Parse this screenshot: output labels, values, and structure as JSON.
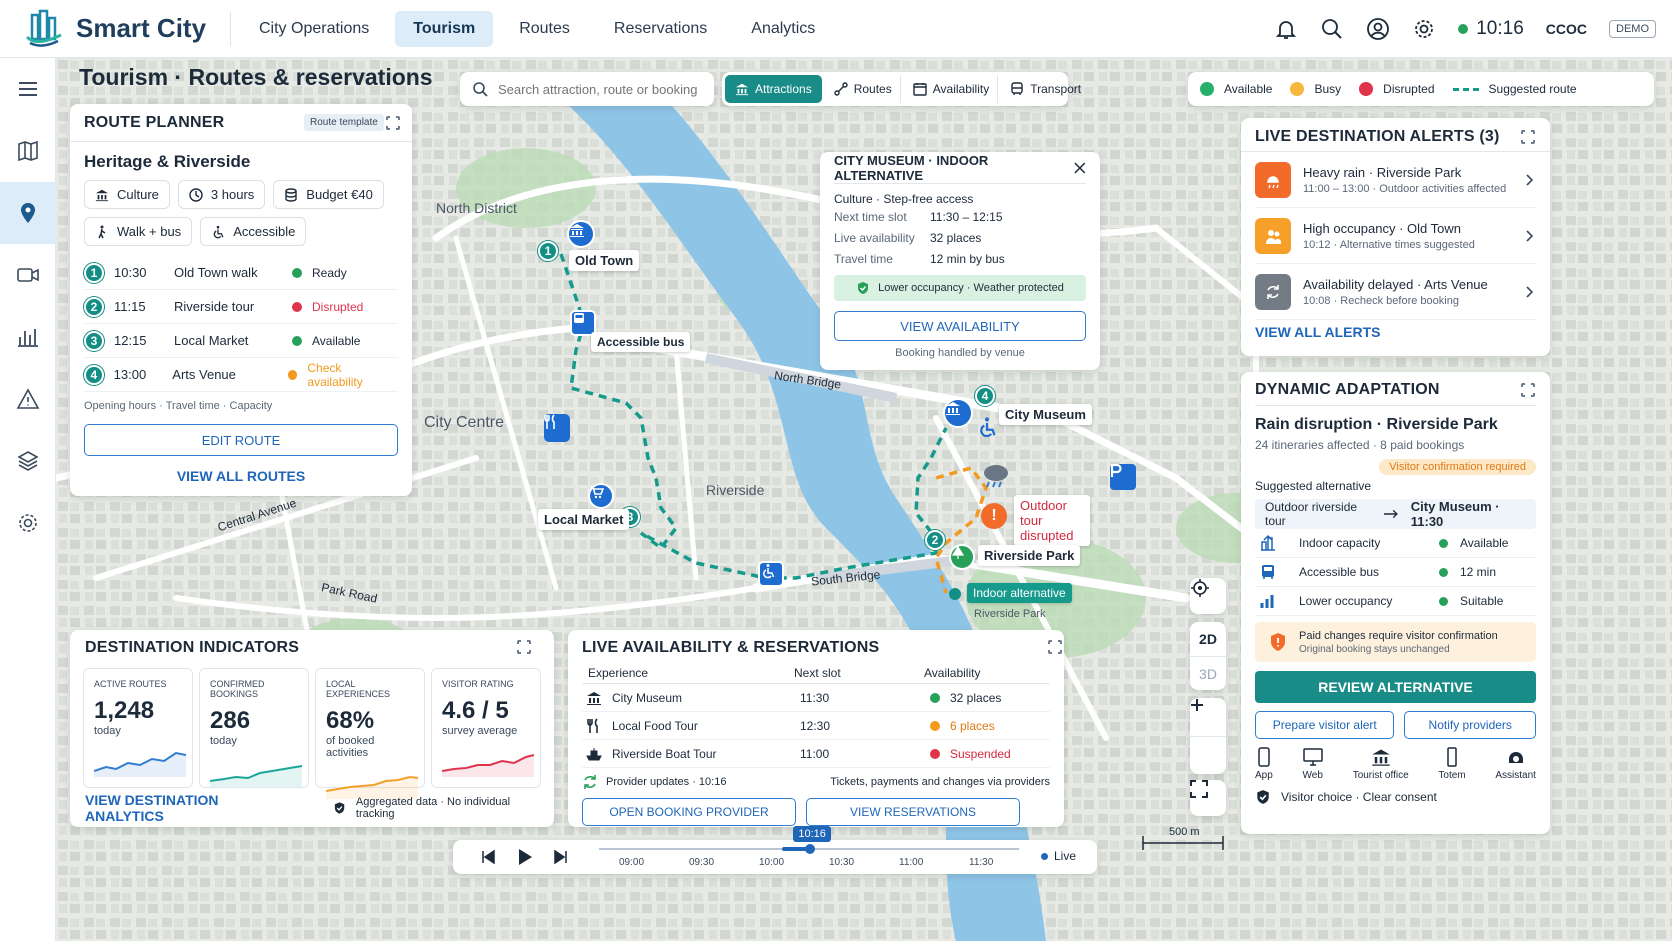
{
  "app": {
    "brand": "Smart City",
    "time": "10:16",
    "org": "CCOC",
    "demo": "DEMO"
  },
  "nav": [
    "City Operations",
    "Tourism",
    "Routes",
    "Reservations",
    "Analytics"
  ],
  "page_title": "Tourism · Routes & reservations",
  "search": {
    "placeholder": "Search attraction, route or booking..."
  },
  "filters": [
    "Attractions",
    "Routes",
    "Availability",
    "Transport"
  ],
  "legend": {
    "available": "Available",
    "busy": "Busy",
    "disrupted": "Disrupted",
    "suggested": "Suggested route"
  },
  "route_planner": {
    "title": "ROUTE PLANNER",
    "template": "Route template",
    "route_name": "Heritage & Riverside",
    "tags": [
      "Culture",
      "3 hours",
      "Budget €40",
      "Walk + bus",
      "Accessible"
    ],
    "stops": [
      {
        "n": "1",
        "time": "10:30",
        "name": "Old Town walk",
        "status": "Ready",
        "color": "#27a05a"
      },
      {
        "n": "2",
        "time": "11:15",
        "name": "Riverside tour",
        "status": "Disrupted",
        "color": "#e0344a"
      },
      {
        "n": "3",
        "time": "12:15",
        "name": "Local Market",
        "status": "Available",
        "color": "#27a05a"
      },
      {
        "n": "4",
        "time": "13:00",
        "name": "Arts Venue",
        "status": "Check availability",
        "color": "#f39a1e"
      }
    ],
    "footnote": "Opening hours · Travel time · Capacity",
    "edit": "EDIT ROUTE",
    "view_all": "VIEW ALL ROUTES"
  },
  "museum_popup": {
    "title": "CITY MUSEUM · INDOOR ALTERNATIVE",
    "subtitle": "Culture · Step-free access",
    "rows": [
      {
        "k": "Next time slot",
        "v": "11:30 – 12:15"
      },
      {
        "k": "Live availability",
        "v": "32 places"
      },
      {
        "k": "Travel time",
        "v": "12 min by bus"
      }
    ],
    "badge": "Lower occupancy · Weather protected",
    "button": "VIEW AVAILABILITY",
    "note": "Booking handled by venue"
  },
  "map_labels": {
    "north_district": "North District",
    "city_centre": "City Centre",
    "riverside": "Riverside",
    "old_town": "Old Town",
    "accessible_bus": "Accessible bus",
    "local_market": "Local Market",
    "city_museum": "City Museum",
    "riverside_park": "Riverside Park",
    "outdoor_tour": "Outdoor tour disrupted",
    "indoor_alt": "Indoor alternative",
    "riverside_park_small": "Riverside Park",
    "north_bridge": "North Bridge",
    "south_bridge": "South Bridge",
    "central_avenue": "Central Avenue",
    "park_road": "Park Road",
    "scale": "500 m"
  },
  "map_controls": {
    "d2": "2D",
    "d3": "3D"
  },
  "alerts": {
    "title": "LIVE DESTINATION ALERTS (3)",
    "items": [
      {
        "title": "Heavy rain · Riverside Park",
        "sub": "11:00 – 13:00 · Outdoor activities affected",
        "color": "#f26b2a"
      },
      {
        "title": "High occupancy · Old Town",
        "sub": "10:12 · Alternative times suggested",
        "color": "#f6a02a"
      },
      {
        "title": "Availability delayed · Arts Venue",
        "sub": "10:08 · Recheck before booking",
        "color": "#737b84"
      }
    ],
    "view_all": "VIEW ALL ALERTS"
  },
  "adaptation": {
    "title": "DYNAMIC ADAPTATION",
    "headline": "Rain disruption · Riverside Park",
    "sub": "24 itineraries affected · 8 paid bookings",
    "badge": "Visitor confirmation required",
    "suggested_label": "Suggested alternative",
    "from": "Outdoor riverside tour",
    "to": "City Museum · 11:30",
    "rows": [
      {
        "k": "Indoor capacity",
        "v": "Available"
      },
      {
        "k": "Accessible bus",
        "v": "12 min"
      },
      {
        "k": "Lower occupancy",
        "v": "Suitable"
      }
    ],
    "warn_title": "Paid changes require visitor confirmation",
    "warn_sub": "Original booking stays unchanged",
    "review": "REVIEW ALTERNATIVE",
    "prepare": "Prepare visitor alert",
    "notify": "Notify providers",
    "channels": [
      "App",
      "Web",
      "Tourist office",
      "Totem",
      "Assistant"
    ],
    "footer": "Visitor choice · Clear consent"
  },
  "indicators": {
    "title": "DESTINATION INDICATORS",
    "cards": [
      {
        "label": "ACTIVE ROUTES",
        "value": "1,248",
        "sub": "today",
        "color": "#2e7dd1"
      },
      {
        "label": "CONFIRMED BOOKINGS",
        "value": "286",
        "sub": "today",
        "color": "#1aa79a"
      },
      {
        "label": "LOCAL EXPERIENCES",
        "value": "68%",
        "sub": "of booked activities",
        "color": "#f3a02a"
      },
      {
        "label": "VISITOR RATING",
        "value": "4.6 / 5",
        "sub": "survey average",
        "color": "#e0344a"
      }
    ],
    "link": "VIEW DESTINATION ANALYTICS",
    "privacy": "Aggregated data · No individual tracking"
  },
  "availability": {
    "title": "LIVE AVAILABILITY & RESERVATIONS",
    "headers": [
      "Experience",
      "Next slot",
      "Availability"
    ],
    "rows": [
      {
        "name": "City Museum",
        "slot": "11:30",
        "avail": "32 places",
        "color": "#27a05a",
        "tc": "#1d2a3a"
      },
      {
        "name": "Local Food Tour",
        "slot": "12:30",
        "avail": "6 places",
        "color": "#f39a1e",
        "tc": "#e07a10"
      },
      {
        "name": "Riverside Boat Tour",
        "slot": "11:00",
        "avail": "Suspended",
        "color": "#e0344a",
        "tc": "#d42a3f"
      }
    ],
    "updates": "Provider updates · 10:16",
    "note": "Tickets, payments and changes via providers",
    "open": "OPEN BOOKING PROVIDER",
    "view": "VIEW RESERVATIONS"
  },
  "timeline": {
    "current": "10:16",
    "ticks": [
      "09:00",
      "09:30",
      "10:00",
      "10:30",
      "11:00",
      "11:30"
    ],
    "live": "Live"
  }
}
